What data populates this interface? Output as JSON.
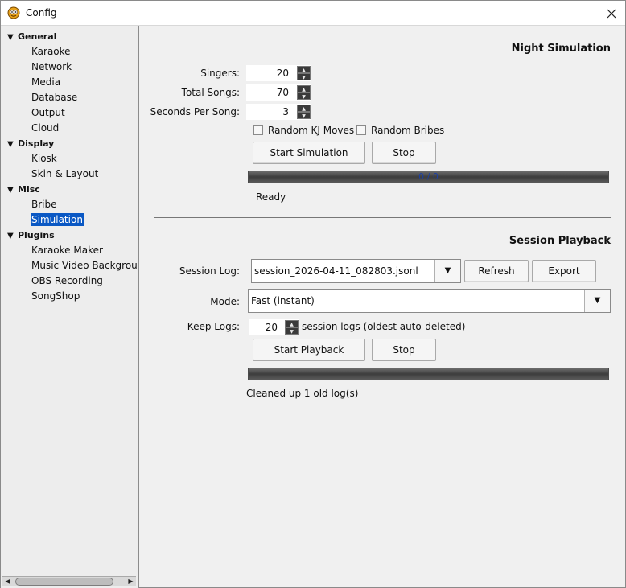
{
  "window": {
    "title": "Config"
  },
  "sidebar": {
    "groups": [
      {
        "label": "General",
        "items": [
          "Karaoke",
          "Network",
          "Media",
          "Database",
          "Output",
          "Cloud"
        ]
      },
      {
        "label": "Display",
        "items": [
          "Kiosk",
          "Skin & Layout"
        ]
      },
      {
        "label": "Misc",
        "items": [
          "Bribe",
          "Simulation"
        ]
      },
      {
        "label": "Plugins",
        "items": [
          "Karaoke Maker",
          "Music Video Background",
          "OBS Recording",
          "SongShop"
        ]
      }
    ],
    "selected": "Simulation"
  },
  "night_sim": {
    "title": "Night Simulation",
    "singers_label": "Singers:",
    "singers_value": "20",
    "total_songs_label": "Total Songs:",
    "total_songs_value": "70",
    "seconds_label": "Seconds Per Song:",
    "seconds_value": "3",
    "random_kj_label": "Random KJ Moves",
    "random_bribes_label": "Random Bribes",
    "start_label": "Start Simulation",
    "stop_label": "Stop",
    "progress_text": "0 / 0",
    "status": "Ready"
  },
  "session": {
    "title": "Session Playback",
    "log_label": "Session Log:",
    "log_value": "session_2026-04-11_082803.jsonl",
    "refresh_label": "Refresh",
    "export_label": "Export",
    "mode_label": "Mode:",
    "mode_value": "Fast (instant)",
    "keep_label": "Keep Logs:",
    "keep_value": "20",
    "keep_suffix": "session logs (oldest auto-deleted)",
    "start_label": "Start Playback",
    "stop_label": "Stop",
    "status": "Cleaned up 1 old log(s)"
  }
}
